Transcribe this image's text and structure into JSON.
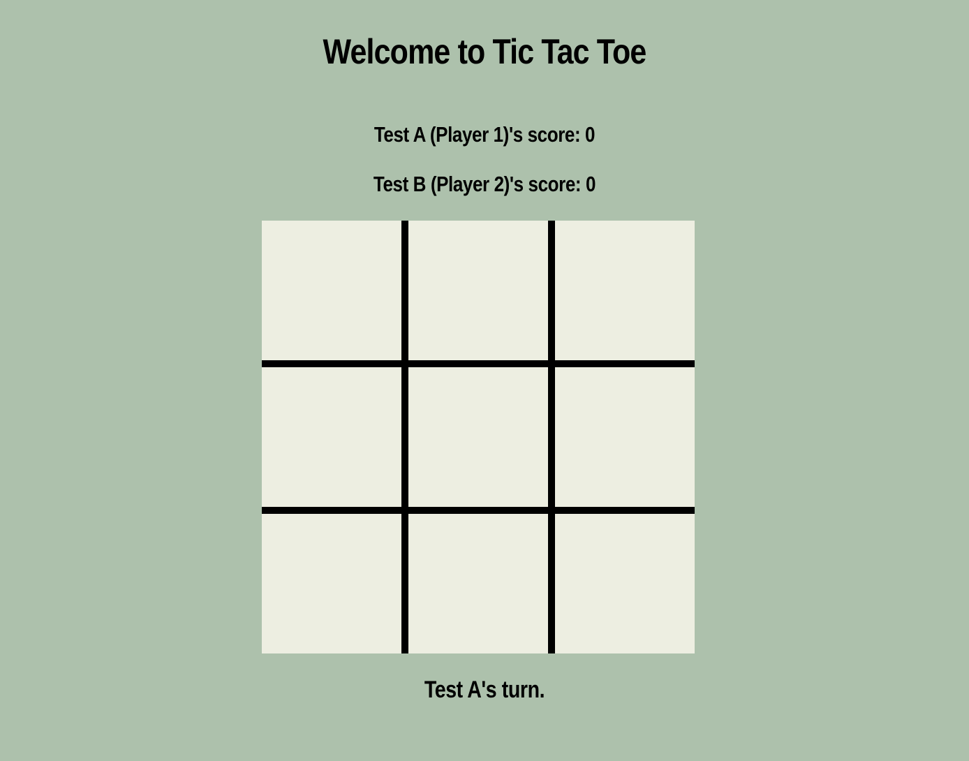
{
  "header": {
    "title": "Welcome to Tic Tac Toe"
  },
  "scores": {
    "player1": "Test A (Player 1)'s score: 0",
    "player2": "Test B (Player 2)'s score: 0"
  },
  "board": {
    "cells": [
      "",
      "",
      "",
      "",
      "",
      "",
      "",
      "",
      ""
    ]
  },
  "status": {
    "turn": "Test A's turn."
  },
  "colors": {
    "background": "#adc1ac",
    "cell": "#edeee1",
    "grid_lines": "#000000"
  }
}
